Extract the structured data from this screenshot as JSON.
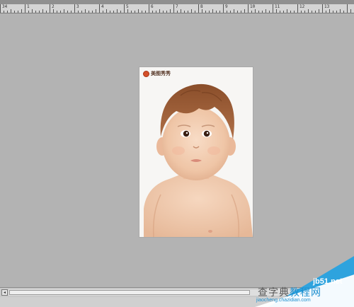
{
  "ruler": {
    "numbers": [
      "34",
      "1",
      "2",
      "3",
      "4",
      "5",
      "6",
      "7",
      "8",
      "9",
      "10",
      "11",
      "12",
      "13"
    ]
  },
  "document": {
    "stamp_text": "美图秀秀"
  },
  "scrollbar": {
    "left_arrow": "◂"
  },
  "watermark": {
    "site": "jb51.net",
    "title_left": "查字典",
    "title_right": "教程网",
    "url": "jiaocheng.chazidian.com"
  },
  "colors": {
    "background": "#b3b3b3",
    "accent": "#2ea3de"
  }
}
